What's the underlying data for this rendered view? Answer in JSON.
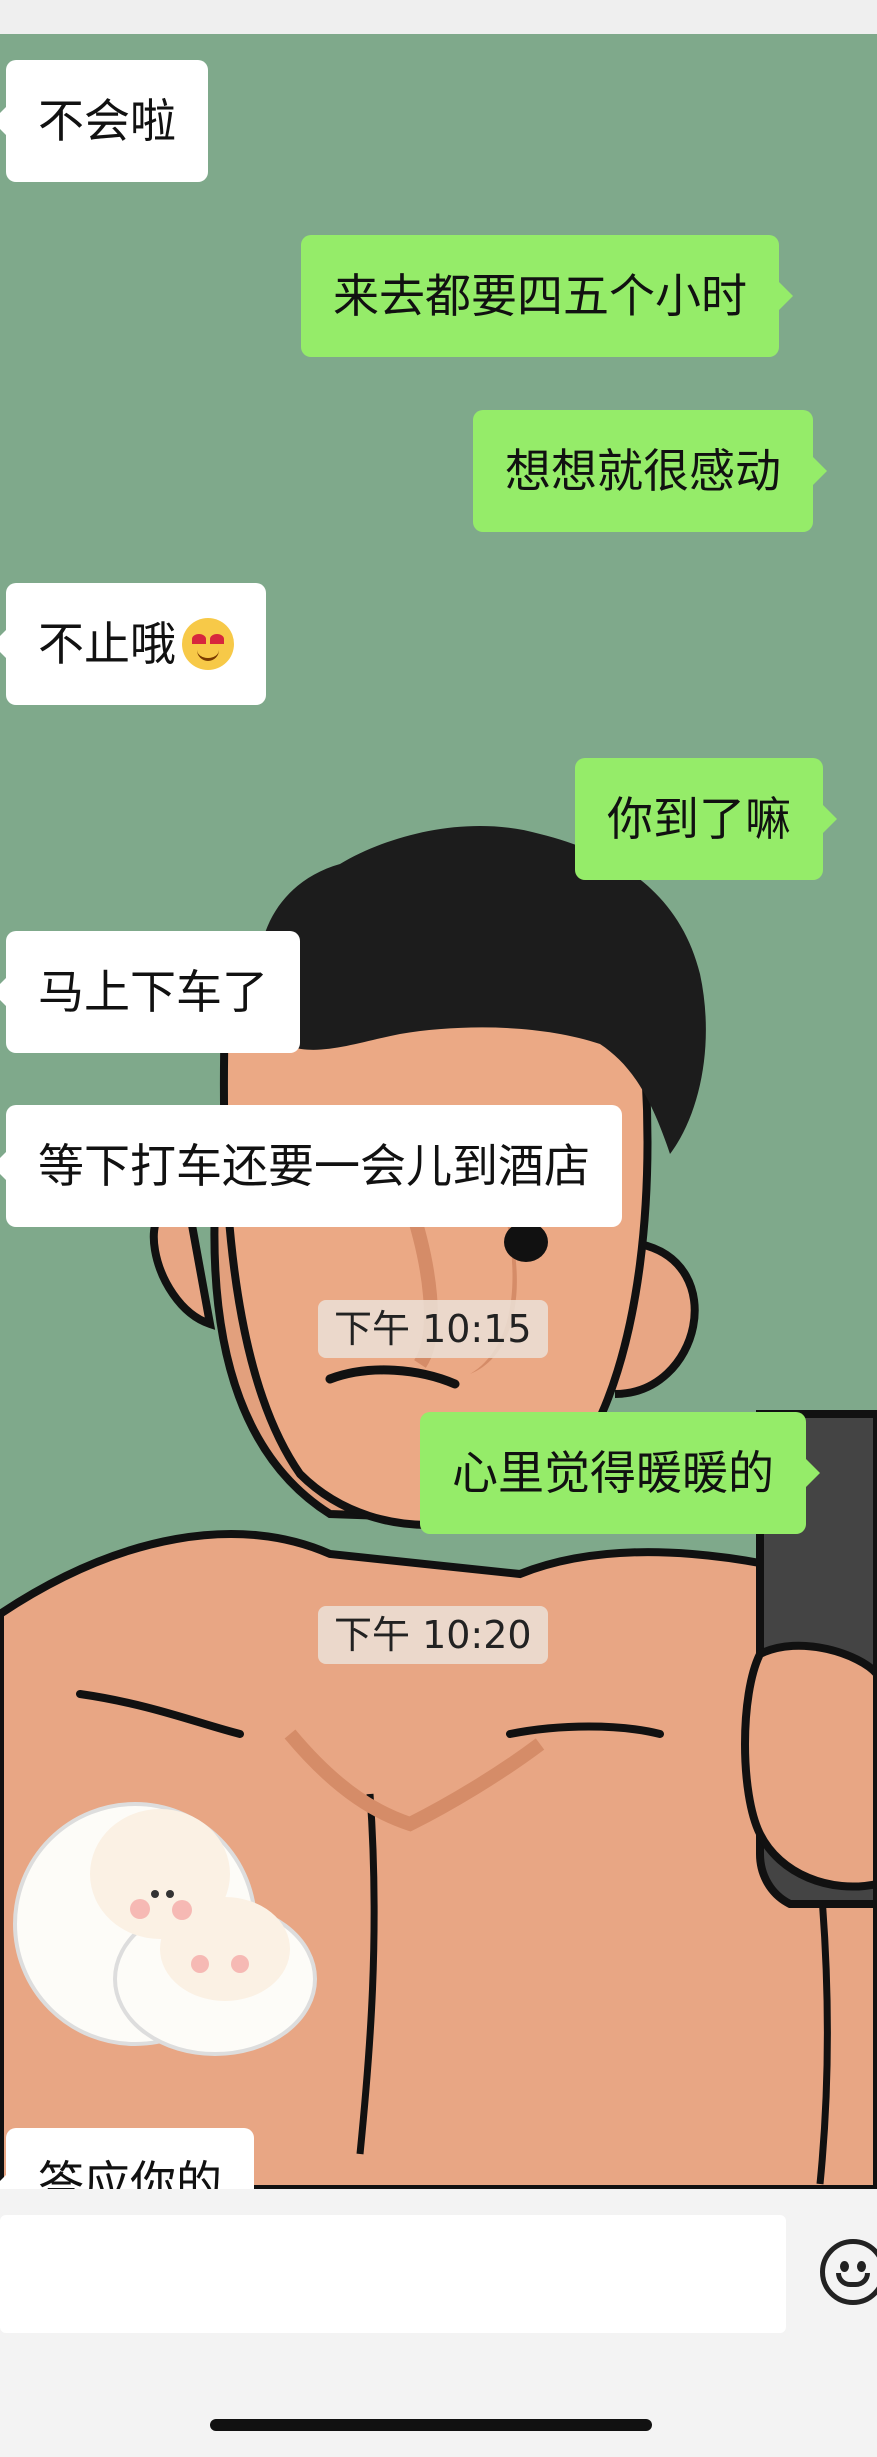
{
  "messages": [
    {
      "side": "left",
      "text": "不会啦"
    },
    {
      "side": "right",
      "text": "来去都要四五个小时"
    },
    {
      "side": "right",
      "text": "想想就很感动"
    },
    {
      "side": "left",
      "text": "不止哦",
      "emoji": "blushing-smile-emoji"
    },
    {
      "side": "right",
      "text": "你到了嘛"
    },
    {
      "side": "left",
      "text": "马上下车了"
    },
    {
      "side": "left",
      "text": "等下打车还要一会儿到酒店"
    },
    {
      "side": "right",
      "text": "心里觉得暖暖的"
    },
    {
      "side": "left",
      "text": "答应你的"
    }
  ],
  "timestamps": [
    "下午 10:15",
    "下午 10:20"
  ],
  "colors": {
    "wallpaper_green": "#7fa98b",
    "outgoing_bubble": "#95ec69",
    "incoming_bubble": "#ffffff",
    "skin": "#e8a684",
    "hair": "#1c1c1c"
  },
  "icons": {
    "emoji_button": "smiley-face-icon",
    "sticker": "sheep-hug-sticker"
  }
}
